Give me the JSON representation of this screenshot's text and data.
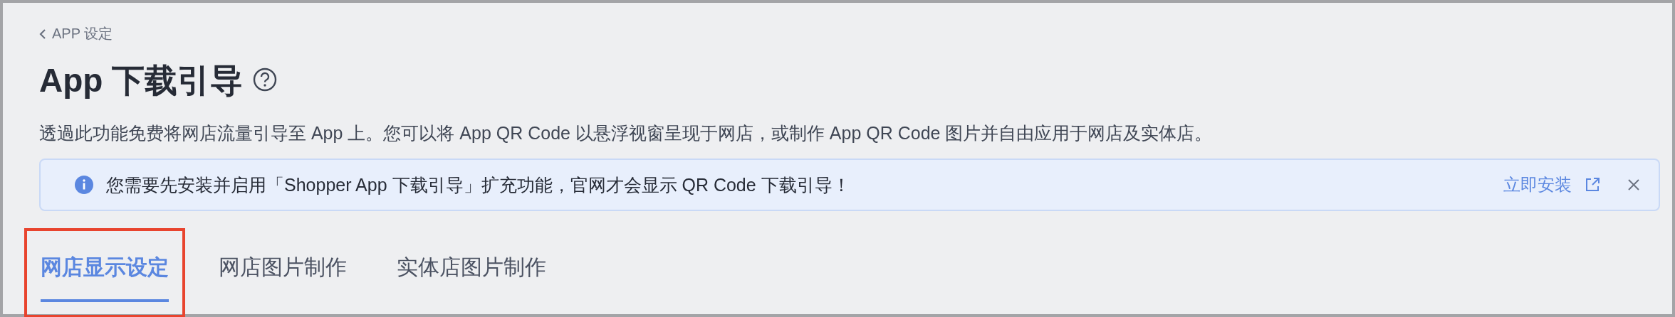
{
  "breadcrumb": {
    "label": "APP 设定"
  },
  "page": {
    "title": "App 下载引导",
    "description": "透過此功能免费将网店流量引导至 App 上。您可以将 App QR Code 以悬浮视窗呈现于网店，或制作 App QR Code 图片并自由应用于网店及实体店。"
  },
  "notice": {
    "message": "您需要先安装并启用「Shopper App 下载引导」扩充功能，官网才会显示 QR Code 下载引导！",
    "action": "立即安装",
    "dismissible": true
  },
  "tabs": [
    {
      "label": "网店显示设定",
      "selected": true,
      "highlighted": true
    },
    {
      "label": "网店图片制作",
      "selected": false,
      "highlighted": false
    },
    {
      "label": "实体店图片制作",
      "selected": false,
      "highlighted": false
    }
  ]
}
